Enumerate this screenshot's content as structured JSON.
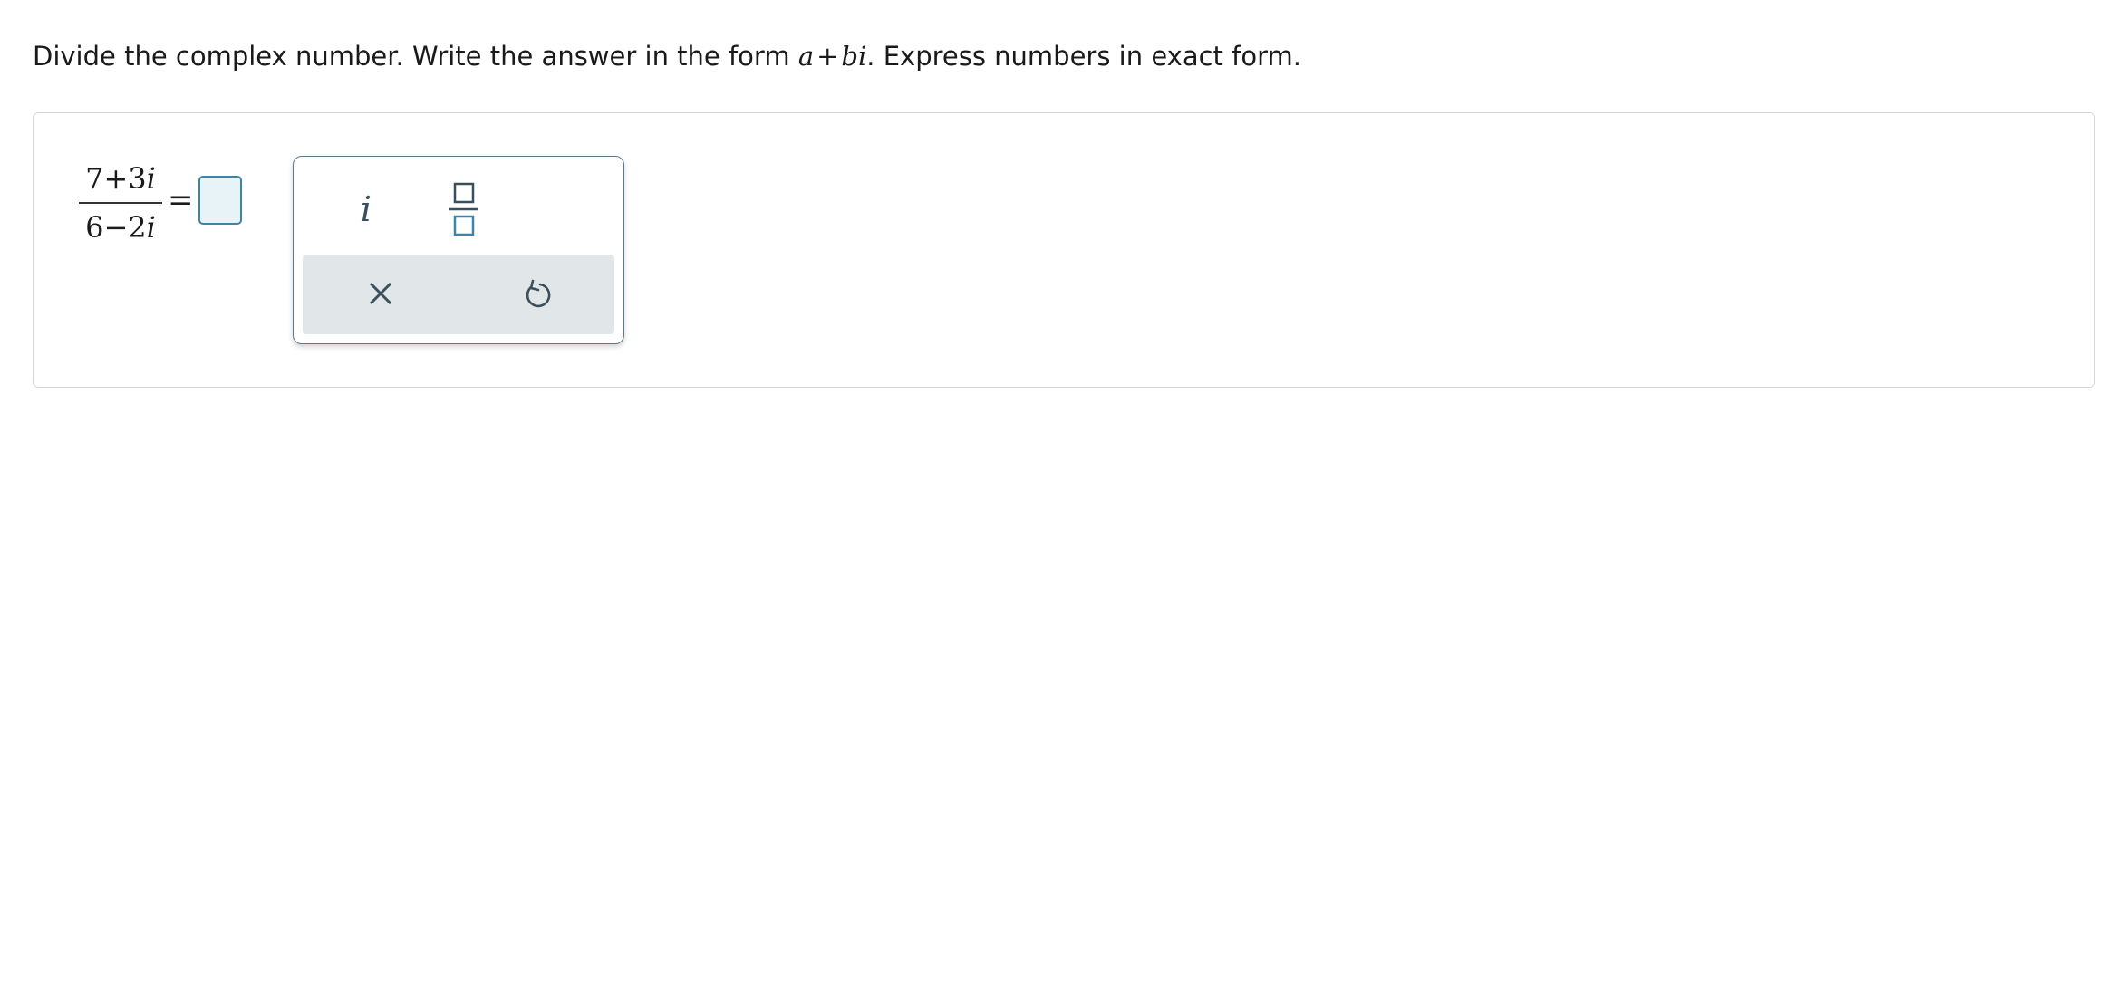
{
  "question": {
    "prompt_prefix": "Divide the complex number. Write the answer in the form",
    "form_a": "a",
    "form_plus": "+",
    "form_bi": "bi",
    "prompt_suffix": ". Express numbers in exact form."
  },
  "expression": {
    "numerator_const": "7",
    "numerator_op": "+",
    "numerator_coef": "3",
    "numerator_unit": "i",
    "denominator_const": "6",
    "denominator_op": "−",
    "denominator_coef": "2",
    "denominator_unit": "i",
    "equals": "="
  },
  "answer": {
    "value": ""
  },
  "keypad": {
    "imaginary_key_label": "i",
    "fraction_key_icon": "fraction-template-icon",
    "clear_key_icon": "close-icon",
    "undo_key_icon": "undo-icon"
  },
  "colors": {
    "accent": "#3c84a8",
    "answer_fill": "#e8f3f7",
    "keypad_border": "#5a7a8a",
    "action_bar": "#e1e6e8",
    "icon": "#3a4f5c"
  }
}
